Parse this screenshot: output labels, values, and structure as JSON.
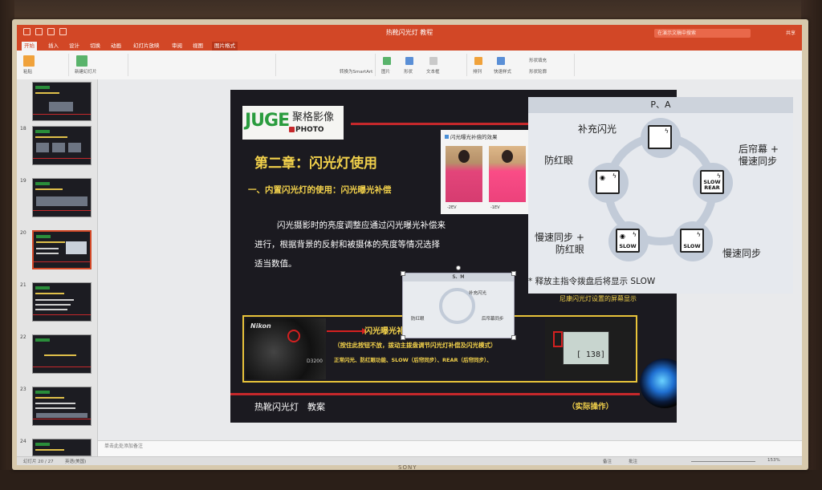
{
  "window": {
    "title": "热靴闪光灯 教程",
    "search_placeholder": "在演示文稿中搜索",
    "share": "共享"
  },
  "tabs": [
    "开始",
    "插入",
    "设计",
    "切换",
    "动画",
    "幻灯片放映",
    "审阅",
    "视图",
    "图片格式"
  ],
  "active_tab": "开始",
  "ribbon": {
    "paste": "粘贴",
    "new_slide": "新建幻灯片",
    "convert": "转换为SmartArt",
    "picture": "图片",
    "shape": "形状",
    "textbox": "文本框",
    "arrange": "排列",
    "quick_style": "快速样式",
    "shape_fill": "形状填充",
    "shape_outline": "形状轮廓"
  },
  "thumbnails": [
    {
      "num": "18"
    },
    {
      "num": "19"
    },
    {
      "num": "20"
    },
    {
      "num": "21"
    },
    {
      "num": "22"
    },
    {
      "num": "23"
    },
    {
      "num": "24"
    }
  ],
  "slide": {
    "logo_text": "JUGE",
    "logo_cn": "聚格影像",
    "logo_photo": "PHOTO",
    "chapter": "第二章：闪光灯使用",
    "subhead": "一、内置闪光灯的使用：闪光曝光补偿",
    "body": "闪光摄影时的亮度调整应通过闪光曝光补偿来进行，根据背景的反射和被摄体的亮度等情况选择适当数值。",
    "photo_caption": "闪光曝光补偿的效果",
    "photo_left": "-2EV",
    "photo_right": "-1EV",
    "flash_title": "闪光曝光补偿",
    "flash_line1": "（按住此按钮不放，拨动主拨盘调节闪光灯补偿及闪光模式）",
    "flash_line2": "正常闪光、防红眼功能、SLOW（后帘同步）、REAR（后帘同步）、",
    "nikon_caption": "尼康闪光灯设置的屏幕显示",
    "camera_brand": "Nikon",
    "camera_model": "D3200",
    "lcd_value": "[ 138]",
    "footer_left": "热靴闪光灯　教案",
    "footer_right": "（实际操作）"
  },
  "panel": {
    "header": "P、A",
    "labels": {
      "fill": "补充闪光",
      "rear": "后帘幕 +\n慢速同步",
      "slow": "慢速同步",
      "slow_redeye": "慢速同步 +\n防红眼",
      "redeye": "防红眼"
    },
    "note": "* 释放主指令拨盘后将显示 SLOW",
    "mode_text": {
      "slow": "SLOW",
      "rear": "SLOW\nREAR"
    }
  },
  "mini": {
    "header": "S、M",
    "fill": "补充闪光",
    "redeye": "防红眼",
    "rear": "后帘幕同步"
  },
  "notes": "单击此处添加备注",
  "status": {
    "left": "幻灯片 20 / 27",
    "lang": "英语(美国)",
    "notes": "备注",
    "comments": "批注",
    "zoom": "153%"
  },
  "tv_brand": "SONY"
}
